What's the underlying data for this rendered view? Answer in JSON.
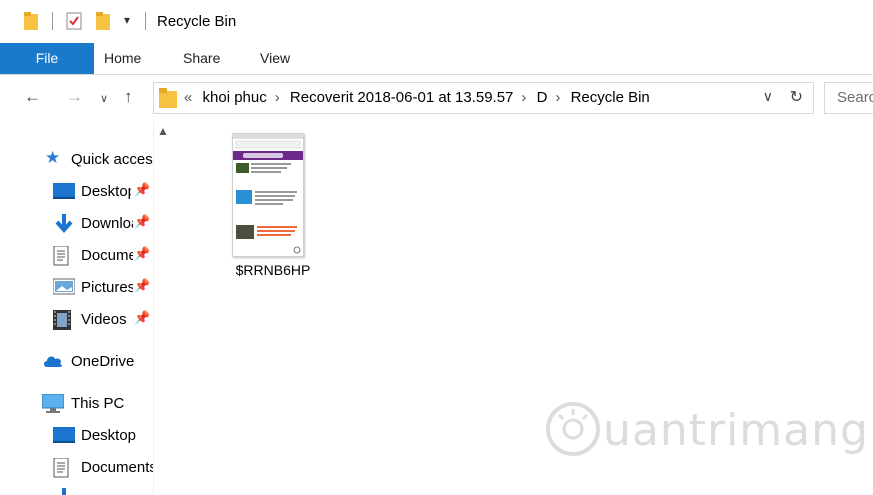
{
  "window": {
    "title": "Recycle Bin"
  },
  "ribbon": {
    "tabs": [
      "File",
      "Home",
      "Share",
      "View"
    ]
  },
  "address": {
    "crumbs": [
      "khoi phuc",
      "Recoverit 2018-06-01 at 13.59.57",
      "D",
      "Recycle Bin"
    ],
    "overflow": "«",
    "search_placeholder": "Search"
  },
  "nav_pane": {
    "quick_access": "Quick access",
    "items": [
      {
        "label": "Desktop",
        "icon": "desktop-icon",
        "pinned": true
      },
      {
        "label": "Downloads",
        "icon": "download-icon",
        "pinned": true
      },
      {
        "label": "Documents",
        "icon": "document-icon",
        "pinned": true
      },
      {
        "label": "Pictures",
        "icon": "pictures-icon",
        "pinned": true
      },
      {
        "label": "Videos",
        "icon": "videos-icon",
        "pinned": true
      }
    ],
    "onedrive": "OneDrive",
    "this_pc": "This PC",
    "pc_items": [
      {
        "label": "Desktop",
        "icon": "desktop-icon"
      },
      {
        "label": "Documents",
        "icon": "document-icon"
      }
    ]
  },
  "files": [
    {
      "name": "$RRNB6HP",
      "type": "image"
    }
  ],
  "watermark": "uantrimang",
  "colors": {
    "accent": "#1979ca",
    "folder": "#f5c242"
  }
}
